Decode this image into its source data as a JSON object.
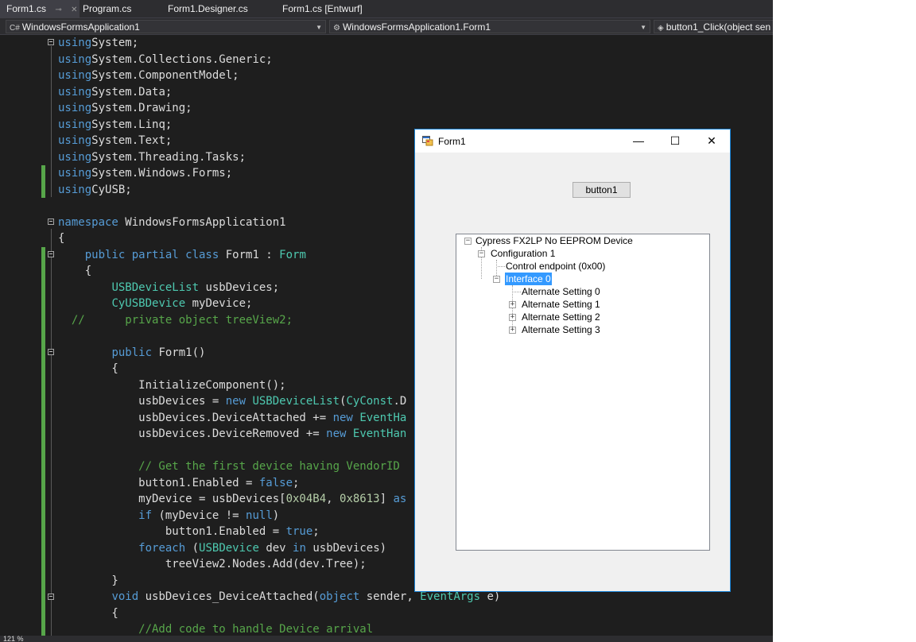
{
  "ide": {
    "tabs": [
      {
        "label": "Form1.cs",
        "active": true
      },
      {
        "label": "Program.cs",
        "active": false
      },
      {
        "label": "Form1.Designer.cs",
        "active": false
      },
      {
        "label": "Form1.cs [Entwurf]",
        "active": false
      }
    ],
    "nav": {
      "project": "WindowsFormsApplication1",
      "class": "WindowsFormsApplication1.Form1",
      "member": "button1_Click(object sen"
    },
    "status": {
      "zoom": "121 %"
    },
    "code_lines": [
      [
        [
          "kw",
          "using"
        ],
        [
          "",
          "System;"
        ]
      ],
      [
        [
          "kw",
          "using"
        ],
        [
          "",
          "System.Collections.Generic;"
        ]
      ],
      [
        [
          "kw",
          "using"
        ],
        [
          "",
          "System.ComponentModel;"
        ]
      ],
      [
        [
          "kw",
          "using"
        ],
        [
          "",
          "System.Data;"
        ]
      ],
      [
        [
          "kw",
          "using"
        ],
        [
          "",
          "System.Drawing;"
        ]
      ],
      [
        [
          "kw",
          "using"
        ],
        [
          "",
          "System.Linq;"
        ]
      ],
      [
        [
          "kw",
          "using"
        ],
        [
          "",
          "System.Text;"
        ]
      ],
      [
        [
          "kw",
          "using"
        ],
        [
          "",
          "System.Threading.Tasks;"
        ]
      ],
      [
        [
          "kw",
          "using"
        ],
        [
          "",
          "System.Windows.Forms;"
        ]
      ],
      [
        [
          "kw",
          "using"
        ],
        [
          "",
          "CyUSB;"
        ]
      ],
      [
        [
          "",
          ""
        ]
      ],
      [
        [
          "kw",
          "namespace"
        ],
        [
          "",
          " WindowsFormsApplication1"
        ]
      ],
      [
        [
          "",
          "{"
        ]
      ],
      [
        [
          "",
          "    "
        ],
        [
          "kw",
          "public partial class"
        ],
        [
          "",
          " Form1 : "
        ],
        [
          "ty",
          "Form"
        ]
      ],
      [
        [
          "",
          "    {"
        ]
      ],
      [
        [
          "",
          "        "
        ],
        [
          "ty",
          "USBDeviceList"
        ],
        [
          "",
          " usbDevices;"
        ]
      ],
      [
        [
          "",
          "        "
        ],
        [
          "ty",
          "CyUSBDevice"
        ],
        [
          "",
          " myDevice;"
        ]
      ],
      [
        [
          "cm",
          "  //      private object treeView2;"
        ]
      ],
      [
        [
          "",
          ""
        ]
      ],
      [
        [
          "",
          "        "
        ],
        [
          "kw",
          "public"
        ],
        [
          "",
          " Form1()"
        ]
      ],
      [
        [
          "",
          "        {"
        ]
      ],
      [
        [
          "",
          "            InitializeComponent();"
        ]
      ],
      [
        [
          "",
          "            usbDevices = "
        ],
        [
          "kw",
          "new"
        ],
        [
          "",
          " "
        ],
        [
          "ty",
          "USBDeviceList"
        ],
        [
          "",
          "("
        ],
        [
          "ty",
          "CyConst"
        ],
        [
          "",
          ".D"
        ]
      ],
      [
        [
          "",
          "            usbDevices.DeviceAttached += "
        ],
        [
          "kw",
          "new"
        ],
        [
          "",
          " "
        ],
        [
          "ty",
          "EventHa"
        ]
      ],
      [
        [
          "",
          "            usbDevices.DeviceRemoved += "
        ],
        [
          "kw",
          "new"
        ],
        [
          "",
          " "
        ],
        [
          "ty",
          "EventHan"
        ]
      ],
      [
        [
          "",
          ""
        ]
      ],
      [
        [
          "cm",
          "            // Get the first device having VendorID"
        ]
      ],
      [
        [
          "",
          "            button1.Enabled = "
        ],
        [
          "kw",
          "false"
        ],
        [
          "",
          ";"
        ]
      ],
      [
        [
          "",
          "            myDevice = usbDevices["
        ],
        [
          "nm",
          "0x04B4"
        ],
        [
          "",
          ", "
        ],
        [
          "nm",
          "0x8613"
        ],
        [
          "",
          "] "
        ],
        [
          "kw",
          "as"
        ]
      ],
      [
        [
          "",
          "            "
        ],
        [
          "kw",
          "if"
        ],
        [
          "",
          " (myDevice != "
        ],
        [
          "kw",
          "null"
        ],
        [
          "",
          ")"
        ]
      ],
      [
        [
          "",
          "                button1.Enabled = "
        ],
        [
          "kw",
          "true"
        ],
        [
          "",
          ";"
        ]
      ],
      [
        [
          "",
          "            "
        ],
        [
          "kw",
          "foreach"
        ],
        [
          "",
          " ("
        ],
        [
          "ty",
          "USBDevice"
        ],
        [
          "",
          " dev "
        ],
        [
          "kw",
          "in"
        ],
        [
          "",
          " usbDevices)"
        ]
      ],
      [
        [
          "",
          "                treeView2.Nodes.Add(dev.Tree);"
        ]
      ],
      [
        [
          "",
          "        }"
        ]
      ],
      [
        [
          "",
          "        "
        ],
        [
          "kw",
          "void"
        ],
        [
          "",
          " usbDevices_DeviceAttached("
        ],
        [
          "kw",
          "object"
        ],
        [
          "",
          " sender, "
        ],
        [
          "ty",
          "EventArgs"
        ],
        [
          "",
          " e)"
        ]
      ],
      [
        [
          "",
          "        {"
        ]
      ],
      [
        [
          "cm",
          "            //Add code to handle Device arrival"
        ]
      ]
    ]
  },
  "form": {
    "title": "Form1",
    "minimize_glyph": "—",
    "maximize_glyph": "☐",
    "close_glyph": "✕",
    "button_label": "button1",
    "tree": {
      "root": "Cypress FX2LP No EEPROM Device",
      "configuration": "Configuration 1",
      "control_endpoint": "Control endpoint (0x00)",
      "interface": "Interface 0",
      "alt0": "Alternate Setting 0",
      "alt1": "Alternate Setting 1",
      "alt2": "Alternate Setting 2",
      "alt3": "Alternate Setting 3"
    }
  }
}
